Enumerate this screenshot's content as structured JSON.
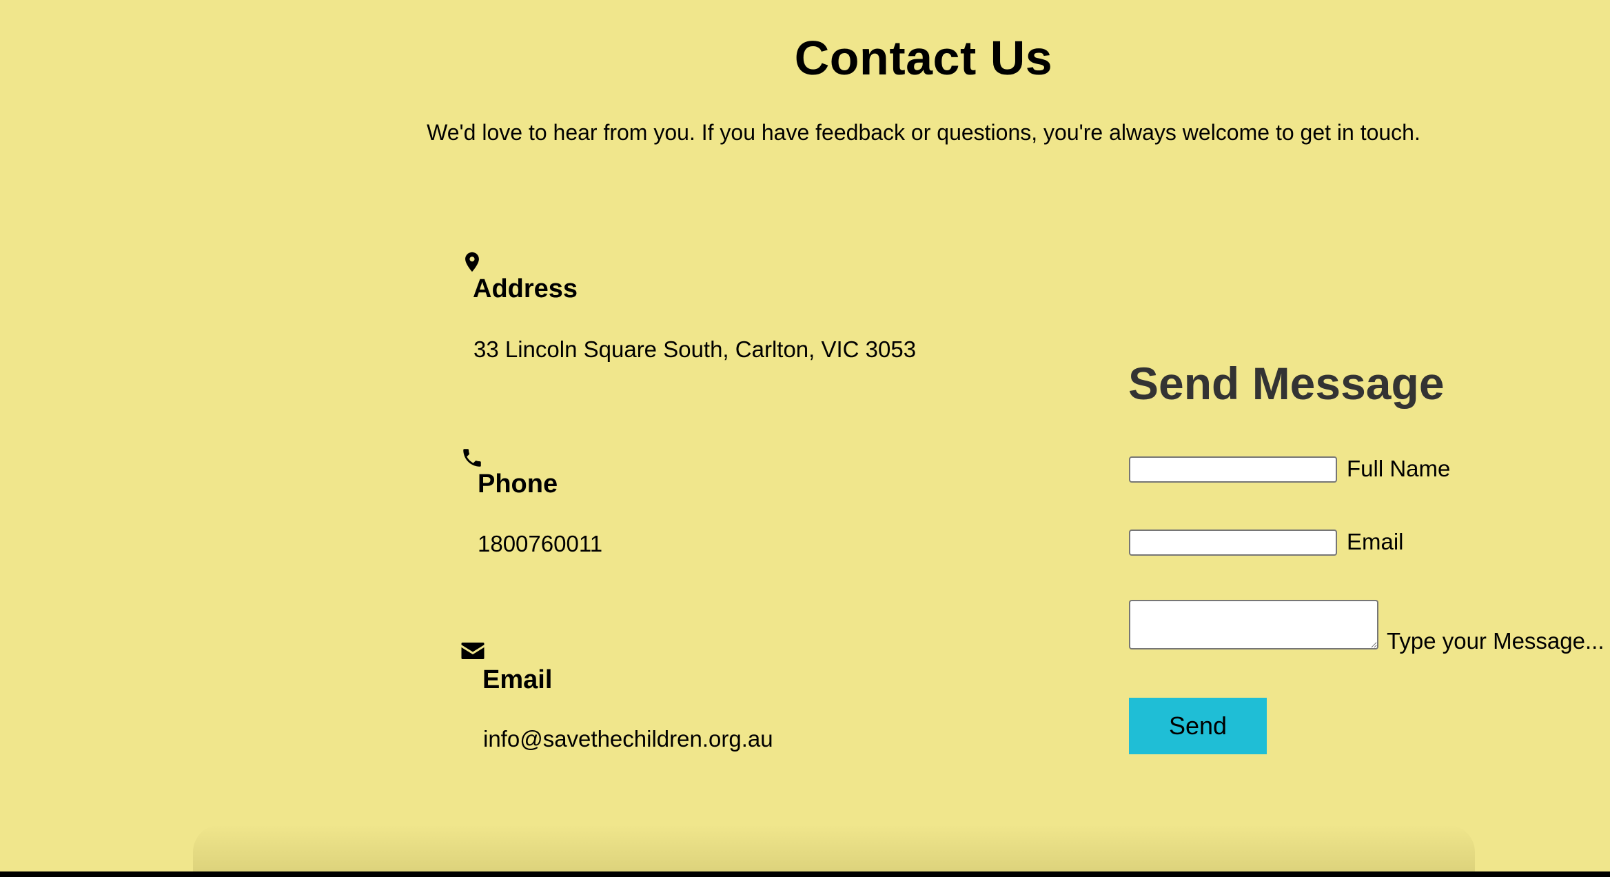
{
  "page": {
    "title": "Contact Us",
    "intro": "We'd love to hear from you. If you have feedback or questions, you're always welcome to get in touch."
  },
  "contact_info": {
    "address": {
      "icon": "map-marker-icon",
      "heading": "Address",
      "value": "33 Lincoln Square South, Carlton, VIC 3053"
    },
    "phone": {
      "icon": "phone-icon",
      "heading": "Phone",
      "value": "1800760011"
    },
    "email": {
      "icon": "envelope-icon",
      "heading": "Email",
      "value": "info@savethechildren.org.au"
    }
  },
  "form": {
    "title": "Send Message",
    "full_name": {
      "label": "Full Name",
      "value": ""
    },
    "email": {
      "label": "Email",
      "value": ""
    },
    "message": {
      "label": "Type your Message...",
      "value": ""
    },
    "send_label": "Send"
  },
  "colors": {
    "background": "#f0e68c",
    "button": "#1fbed6",
    "form_title": "#333333"
  }
}
